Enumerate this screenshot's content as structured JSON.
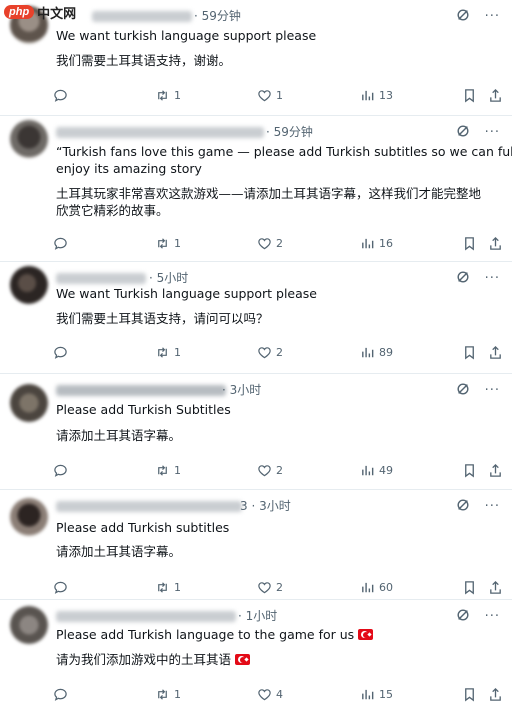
{
  "watermark": {
    "logo": "php",
    "text": "中文网"
  },
  "tweets": [
    {
      "time": "· 59分钟",
      "text_en": [
        "We want turkish language support please"
      ],
      "text_zh": [
        "我们需要土耳其语支持，谢谢。"
      ],
      "replies": "",
      "reposts": "1",
      "likes": "1",
      "views": "13"
    },
    {
      "time": "· 59分钟",
      "text_en": [
        "“Turkish fans love this game — please add Turkish subtitles so we can fully",
        "enjoy its amazing story"
      ],
      "text_zh": [
        "土耳其玩家非常喜欢这款游戏——请添加土耳其语字幕，这样我们才能完整地",
        "欣赏它精彩的故事。"
      ],
      "replies": "",
      "reposts": "1",
      "likes": "2",
      "views": "16"
    },
    {
      "time": "· 5小时",
      "text_en": [
        "We want Turkish language support please"
      ],
      "text_zh": [
        "我们需要土耳其语支持，请问可以吗？"
      ],
      "replies": "",
      "reposts": "1",
      "likes": "2",
      "views": "89"
    },
    {
      "time": "· 3小时",
      "text_en": [
        "Please add Turkish Subtitles"
      ],
      "text_zh": [
        "请添加土耳其语字幕。"
      ],
      "replies": "",
      "reposts": "1",
      "likes": "2",
      "views": "49"
    },
    {
      "time": "3 · 3小时",
      "text_en": [
        "Please add Turkish subtitles"
      ],
      "text_zh": [
        "请添加土耳其语字幕。"
      ],
      "replies": "",
      "reposts": "1",
      "likes": "2",
      "views": "60"
    },
    {
      "time": "· 1小时",
      "text_en": [
        "Please add Turkish language to the game for us"
      ],
      "text_zh": [
        "请为我们添加游戏中的土耳其语"
      ],
      "replies": "",
      "reposts": "1",
      "likes": "4",
      "views": "15"
    }
  ],
  "more_label": "···",
  "colors": {
    "text": "#0f1419",
    "muted": "#536471",
    "flag": "#e30a17"
  }
}
